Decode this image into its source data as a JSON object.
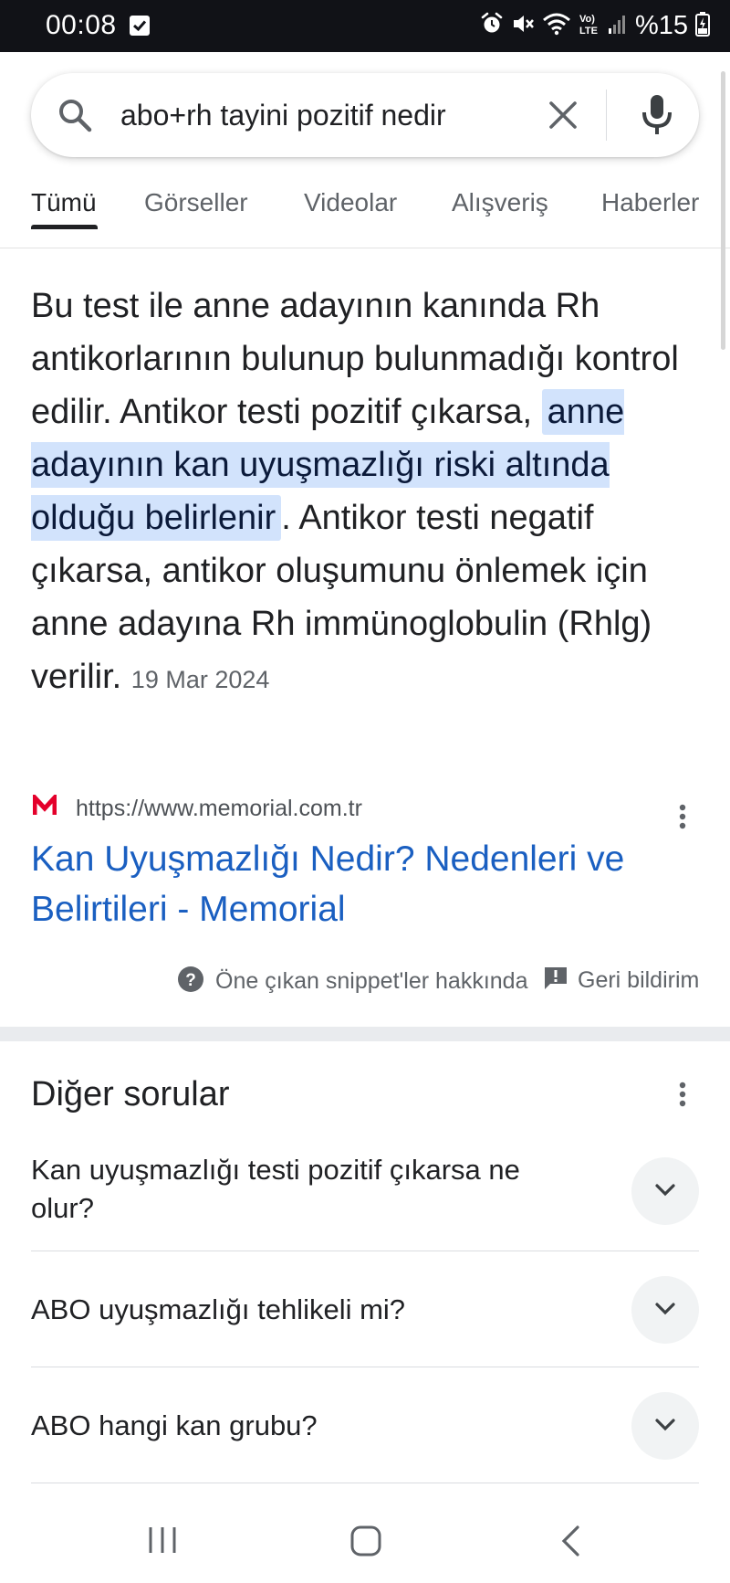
{
  "status_bar": {
    "time": "00:08",
    "battery": "%15",
    "icons": [
      "check-notification-icon",
      "alarm-icon",
      "mute-icon",
      "wifi-icon",
      "volte-icon",
      "signal-icon",
      "battery-charging-icon"
    ]
  },
  "search": {
    "query": "abo+rh tayini pozitif nedir",
    "icons": [
      "search-icon",
      "clear-icon",
      "mic-icon"
    ]
  },
  "tabs": [
    {
      "label": "Tümü",
      "active": true
    },
    {
      "label": "Görseller",
      "active": false
    },
    {
      "label": "Videolar",
      "active": false
    },
    {
      "label": "Alışveriş",
      "active": false
    },
    {
      "label": "Haberler",
      "active": false
    }
  ],
  "snippet": {
    "text_before": "Bu test ile anne adayının kanında Rh antikorlarının bulunup bulunmadığı kontrol edilir. Antikor testi pozitif çıkarsa, ",
    "highlight": "anne adayının kan uyuşmazlığı riski altında olduğu belirlenir",
    "text_after": ". Antikor testi negatif çıkarsa, antikor oluşumunu önlemek için anne adayına Rh immünoglobulin (Rhlg) verilir.",
    "date": "19 Mar 2024"
  },
  "source": {
    "logo_letter": "M",
    "url": "https://www.memorial.com.tr",
    "title": "Kan Uyuşmazlığı Nedir? Nedenleri ve Belirtileri - Memorial",
    "brand_color": "#e4002b"
  },
  "snippet_footer": {
    "about_label": "Öne çıkan snippet'ler hakkında",
    "feedback_label": "Geri bildirim"
  },
  "paa": {
    "heading": "Diğer sorular",
    "questions": [
      "Kan uyuşmazlığı testi pozitif çıkarsa ne olur?",
      "ABO uyuşmazlığı tehlikeli mi?",
      "ABO hangi kan grubu?"
    ]
  },
  "colors": {
    "link": "#1a5fc1",
    "highlight": "#d2e3fc",
    "status_bar": "#111217"
  }
}
